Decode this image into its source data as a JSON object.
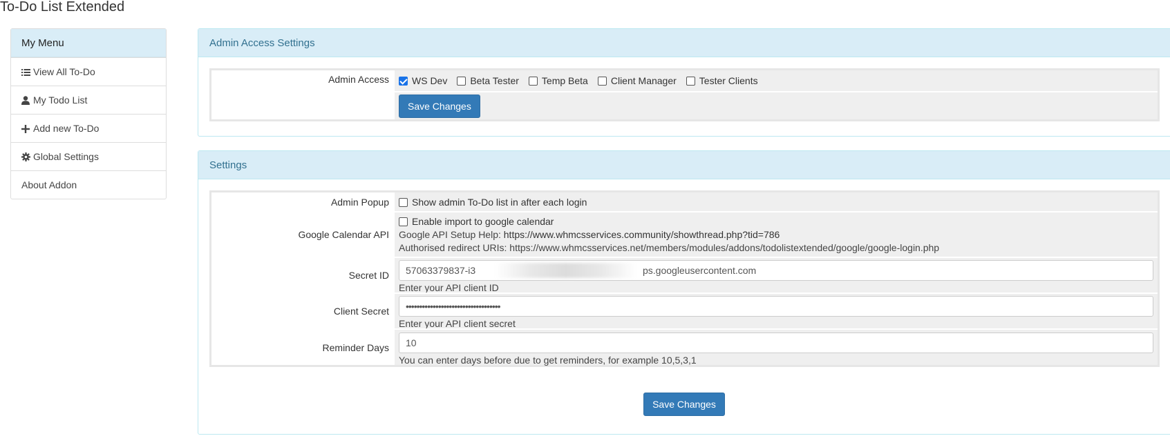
{
  "page": {
    "title": "To-Do List Extended"
  },
  "menu": {
    "heading": "My Menu",
    "items": [
      {
        "label": "View All To-Do",
        "icon": "list-icon"
      },
      {
        "label": "My Todo List",
        "icon": "user-icon"
      },
      {
        "label": "Add new To-Do",
        "icon": "plus-icon"
      },
      {
        "label": "Global Settings",
        "icon": "gear-icon"
      },
      {
        "label": "About Addon",
        "icon": ""
      }
    ]
  },
  "admin_access": {
    "panel_title": "Admin Access Settings",
    "label": "Admin Access",
    "options": [
      {
        "label": "WS Dev",
        "checked": true
      },
      {
        "label": "Beta Tester",
        "checked": false
      },
      {
        "label": "Temp Beta",
        "checked": false
      },
      {
        "label": "Client Manager",
        "checked": false
      },
      {
        "label": "Tester Clients",
        "checked": false
      }
    ],
    "save_label": "Save Changes"
  },
  "settings": {
    "panel_title": "Settings",
    "admin_popup": {
      "label": "Admin Popup",
      "checkbox_label": "Show admin To-Do list in after each login",
      "checked": false
    },
    "google_calendar": {
      "label": "Google Calendar API",
      "checkbox_label": "Enable import to google calendar",
      "checked": false,
      "help_prefix": "Google API Setup Help: ",
      "help_url": "https://www.whmcsservices.community/showthread.php?tid=786",
      "redirect_prefix": "Authorised redirect URIs: ",
      "redirect_url": "https://www.whmcsservices.net/members/modules/addons/todolistextended/google/google-login.php"
    },
    "secret_id": {
      "label": "Secret ID",
      "value_start": "57063379837-i3",
      "value_end": "ps.googleusercontent.com",
      "help": "Enter your API client ID"
    },
    "client_secret": {
      "label": "Client Secret",
      "value": "•••••••••••••••••••••••••••••••••••",
      "help": "Enter your API client secret"
    },
    "reminder_days": {
      "label": "Reminder Days",
      "value": "10",
      "help": "You can enter days before due to get reminders, for example 10,5,3,1"
    },
    "save_label": "Save Changes"
  },
  "colors": {
    "panel_heading_bg": "#d9edf7",
    "panel_heading_text": "#31708f",
    "primary_button": "#337ab7"
  }
}
